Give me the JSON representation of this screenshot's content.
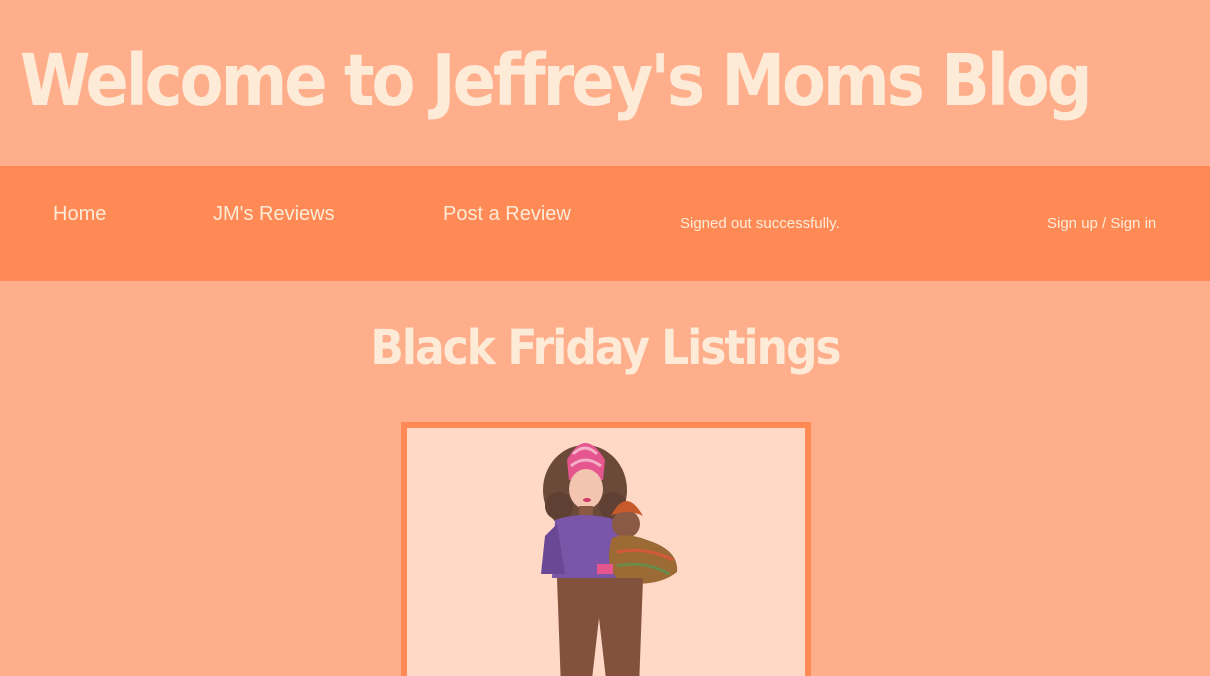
{
  "header": {
    "title": "Welcome to Jeffrey's Moms Blog"
  },
  "nav": {
    "home": "Home",
    "reviews": "JM's Reviews",
    "post_review": "Post a Review",
    "flash_message": "Signed out successfully.",
    "auth": "Sign up / Sign in"
  },
  "main": {
    "heading": "Black Friday Listings"
  },
  "colors": {
    "page_background": "#ffae8b",
    "nav_background": "#ff8a55",
    "title_text": "#fdebd8",
    "card_background": "#ffd8c6",
    "card_border": "#ff8a55"
  },
  "listing": {
    "image": "mother-and-child-illustration"
  }
}
